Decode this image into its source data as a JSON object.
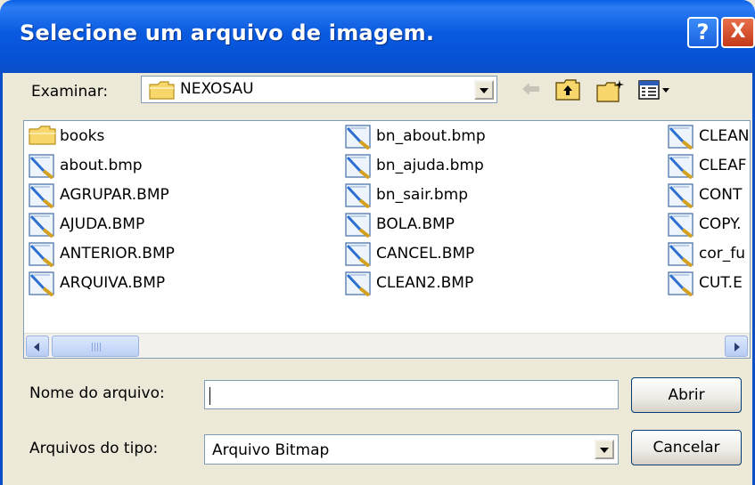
{
  "window": {
    "title": "Selecione um arquivo de imagem."
  },
  "title_buttons": {
    "help": "?",
    "close": "X"
  },
  "lookin": {
    "label": "Examinar:",
    "value": "NEXOSAU"
  },
  "files": [
    {
      "name": "books",
      "type": "folder"
    },
    {
      "name": "about.bmp",
      "type": "bmp"
    },
    {
      "name": "AGRUPAR.BMP",
      "type": "bmp"
    },
    {
      "name": "AJUDA.BMP",
      "type": "bmp"
    },
    {
      "name": "ANTERIOR.BMP",
      "type": "bmp"
    },
    {
      "name": "ARQUIVA.BMP",
      "type": "bmp"
    },
    {
      "name": "bn_about.bmp",
      "type": "bmp"
    },
    {
      "name": "bn_ajuda.bmp",
      "type": "bmp"
    },
    {
      "name": "bn_sair.bmp",
      "type": "bmp"
    },
    {
      "name": "BOLA.BMP",
      "type": "bmp"
    },
    {
      "name": "CANCEL.BMP",
      "type": "bmp"
    },
    {
      "name": "CLEAN2.BMP",
      "type": "bmp"
    },
    {
      "name": "CLEAN",
      "type": "bmp"
    },
    {
      "name": "CLEAF",
      "type": "bmp"
    },
    {
      "name": "CONT",
      "type": "bmp"
    },
    {
      "name": "COPY.",
      "type": "bmp"
    },
    {
      "name": "cor_fu",
      "type": "bmp"
    },
    {
      "name": "CUT.E",
      "type": "bmp"
    }
  ],
  "filename": {
    "label": "Nome do arquivo:",
    "value": ""
  },
  "filetype": {
    "label": "Arquivos do tipo:",
    "value": "Arquivo Bitmap"
  },
  "buttons": {
    "open": "Abrir",
    "cancel": "Cancelar"
  },
  "colors": {
    "titlebar": "#0a5ae0",
    "dialog_bg": "#ece9d8",
    "close_button": "#c4391a",
    "field_border": "#7f9db9"
  }
}
